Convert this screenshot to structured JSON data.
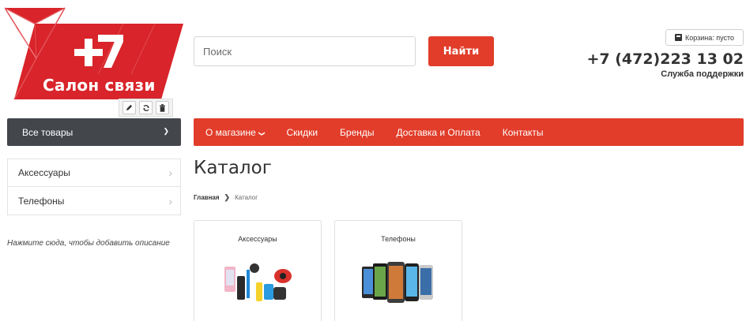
{
  "logo": {
    "text": "Салон связи",
    "symbol": "+7"
  },
  "edit_tools": [
    "pencil-icon",
    "refresh-icon",
    "trash-icon"
  ],
  "search": {
    "placeholder": "Поиск",
    "button": "Найти"
  },
  "cart": {
    "label": "Корзина: пусто"
  },
  "contact": {
    "phone": "+7 (472)223 13 02",
    "support": "Служба поддержки"
  },
  "catalog_button": {
    "label": "Все товары"
  },
  "nav": {
    "items": [
      {
        "label": "О магазине",
        "has_dropdown": true
      },
      {
        "label": "Скидки"
      },
      {
        "label": "Бренды"
      },
      {
        "label": "Доставка и Оплата"
      },
      {
        "label": "Контакты"
      }
    ]
  },
  "sidebar": {
    "items": [
      {
        "label": "Аксессуары"
      },
      {
        "label": "Телефоны"
      }
    ],
    "description": "Нажмите сюда, чтобы добавить описание"
  },
  "page": {
    "title": "Каталог"
  },
  "breadcrumb": {
    "home": "Главная",
    "current": "Каталог"
  },
  "categories": [
    {
      "title": "Аксессуары"
    },
    {
      "title": "Телефоны"
    }
  ],
  "colors": {
    "accent": "#e13d2a",
    "dark": "#43474c"
  }
}
